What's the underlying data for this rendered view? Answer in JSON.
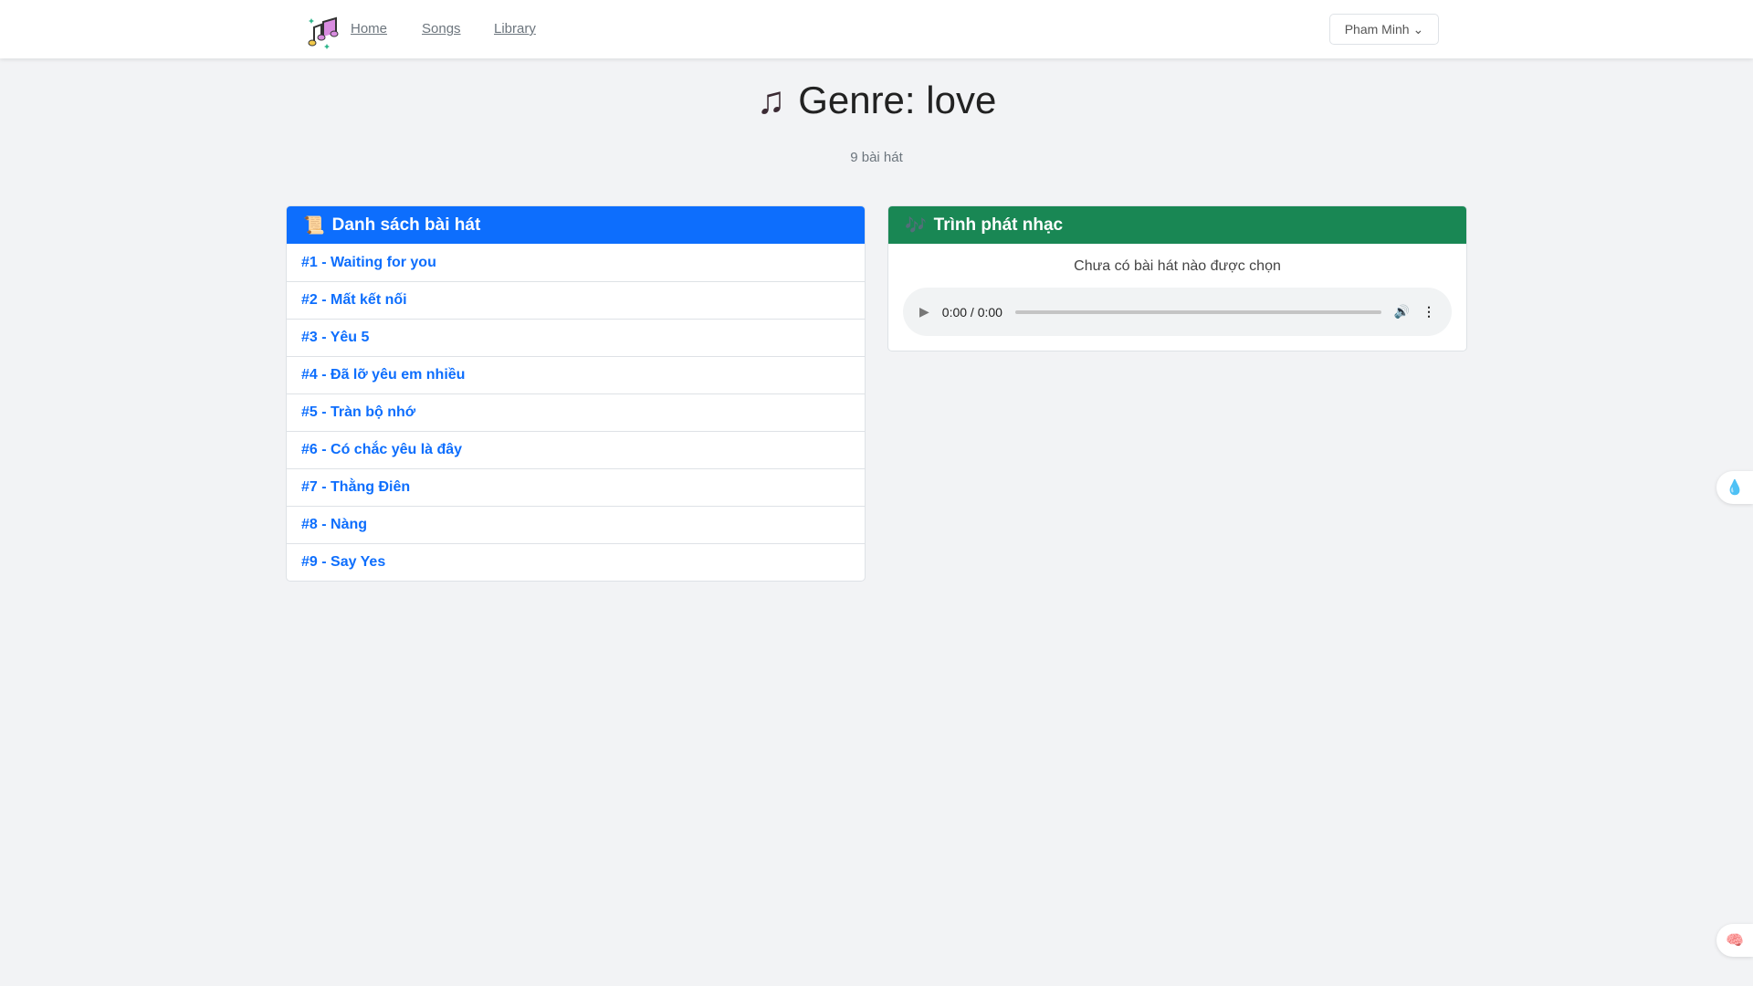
{
  "nav": {
    "links": [
      "Home",
      "Songs",
      "Library"
    ],
    "user": "Pham Minh"
  },
  "page": {
    "title": "Genre: love",
    "count": "9 bài hát"
  },
  "list": {
    "title": "Danh sách bài hát",
    "songs": [
      "#1 - Waiting for you",
      "#2 - Mất kết nối",
      "#3 - Yêu 5",
      "#4 - Đã lỡ yêu em nhiều",
      "#5 - Tràn bộ nhớ",
      "#6 - Có chắc yêu là đây",
      "#7 - Thằng Điên",
      "#8 - Nàng",
      "#9 - Say Yes"
    ]
  },
  "player": {
    "title": "Trình phát nhạc",
    "empty": "Chưa có bài hát nào được chọn",
    "time": "0:00 / 0:00"
  },
  "colors": {
    "list_header": "#0d6efd",
    "player_header": "#198754"
  }
}
